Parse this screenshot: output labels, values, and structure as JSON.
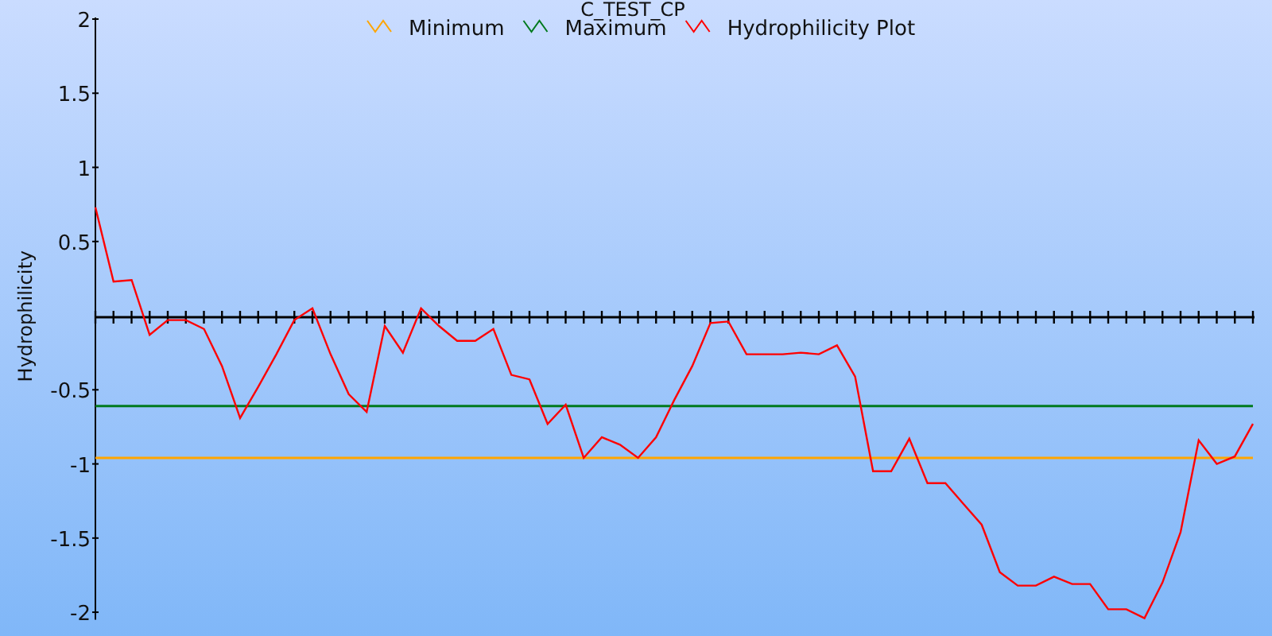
{
  "chart": {
    "chart_data": {
      "type": "line",
      "title": "C_TEST_CP",
      "ylabel": "Hydrophilicity",
      "categories": [
        null,
        null,
        null,
        null,
        null,
        null,
        null,
        null,
        null,
        null,
        null,
        null,
        null,
        null,
        null,
        null,
        null,
        null,
        null,
        null,
        null,
        null,
        null,
        null,
        null,
        null,
        null,
        null,
        null,
        null,
        null,
        null,
        null,
        null,
        null,
        null,
        null,
        null,
        null,
        null,
        null,
        null,
        null,
        null,
        null,
        null,
        null,
        null,
        null,
        null,
        null,
        null,
        null,
        null,
        null,
        null,
        null,
        null,
        null,
        null,
        null,
        null,
        null,
        null,
        null
      ],
      "ylim": [
        -2.05,
        2
      ],
      "legend": true,
      "yticks": [
        {
          "value": -2,
          "label": "-2"
        },
        {
          "value": -1.5,
          "label": "-1.5"
        },
        {
          "value": -1,
          "label": "-1"
        },
        {
          "value": -0.5,
          "label": "-0.5"
        },
        {
          "value": 0.5,
          "label": "0.5"
        },
        {
          "value": 1,
          "label": "1"
        },
        {
          "value": 1.5,
          "label": "1.5"
        },
        {
          "value": 2,
          "label": "2"
        }
      ],
      "series": [
        {
          "name": "Minimum",
          "color": "#ffa500",
          "values": [
            -0.96,
            -0.96,
            -0.96,
            -0.96,
            -0.96,
            -0.96,
            -0.96,
            -0.96,
            -0.96,
            -0.96,
            -0.96,
            -0.96,
            -0.96,
            -0.96,
            -0.96,
            -0.96,
            -0.96,
            -0.96,
            -0.96,
            -0.96,
            -0.96,
            -0.96,
            -0.96,
            -0.96,
            -0.96,
            -0.96,
            -0.96,
            -0.96,
            -0.96,
            -0.96,
            -0.96,
            -0.96,
            -0.96,
            -0.96,
            -0.96,
            -0.96,
            -0.96,
            -0.96,
            -0.96,
            -0.96,
            -0.96,
            -0.96,
            -0.96,
            -0.96,
            -0.96,
            -0.96,
            -0.96,
            -0.96,
            -0.96,
            -0.96,
            -0.96,
            -0.96,
            -0.96,
            -0.96,
            -0.96,
            -0.96,
            -0.96,
            -0.96,
            -0.96,
            -0.96,
            -0.96,
            -0.96,
            -0.96,
            -0.96,
            -0.96
          ]
        },
        {
          "name": "Maximum",
          "color": "#007a1e",
          "values": [
            -0.61,
            -0.61,
            -0.61,
            -0.61,
            -0.61,
            -0.61,
            -0.61,
            -0.61,
            -0.61,
            -0.61,
            -0.61,
            -0.61,
            -0.61,
            -0.61,
            -0.61,
            -0.61,
            -0.61,
            -0.61,
            -0.61,
            -0.61,
            -0.61,
            -0.61,
            -0.61,
            -0.61,
            -0.61,
            -0.61,
            -0.61,
            -0.61,
            -0.61,
            -0.61,
            -0.61,
            -0.61,
            -0.61,
            -0.61,
            -0.61,
            -0.61,
            -0.61,
            -0.61,
            -0.61,
            -0.61,
            -0.61,
            -0.61,
            -0.61,
            -0.61,
            -0.61,
            -0.61,
            -0.61,
            -0.61,
            -0.61,
            -0.61,
            -0.61,
            -0.61,
            -0.61,
            -0.61,
            -0.61,
            -0.61,
            -0.61,
            -0.61,
            -0.61,
            -0.61,
            -0.61,
            -0.61,
            -0.61,
            -0.61,
            -0.61
          ]
        },
        {
          "name": "Hydrophilicity Plot",
          "color": "#ff0000",
          "values": [
            0.73,
            0.23,
            0.24,
            -0.13,
            -0.03,
            -0.03,
            -0.09,
            -0.34,
            -0.69,
            -0.48,
            -0.26,
            -0.03,
            0.05,
            -0.26,
            -0.53,
            -0.65,
            -0.07,
            -0.25,
            0.05,
            -0.07,
            -0.17,
            -0.17,
            -0.09,
            -0.4,
            -0.43,
            -0.73,
            -0.6,
            -0.96,
            -0.82,
            -0.87,
            -0.96,
            -0.82,
            -0.57,
            -0.34,
            -0.05,
            -0.04,
            -0.26,
            -0.26,
            -0.26,
            -0.25,
            -0.26,
            -0.2,
            -0.41,
            -1.05,
            -1.05,
            -0.83,
            -1.13,
            -1.13,
            -1.27,
            -1.41,
            -1.73,
            -1.82,
            -1.82,
            -1.76,
            -1.81,
            -1.81,
            -1.98,
            -1.98,
            -2.04,
            -1.8,
            -1.46,
            -0.84,
            -1,
            -0.95,
            -0.73
          ]
        }
      ]
    }
  }
}
